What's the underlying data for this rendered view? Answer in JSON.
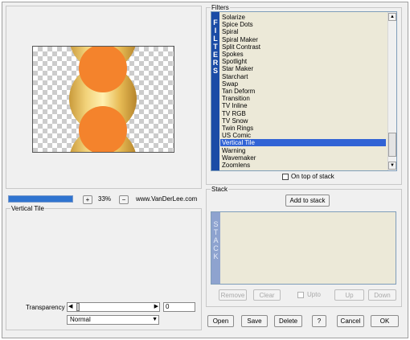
{
  "preview": {
    "zoom_plus": "+",
    "zoom_value": "33%",
    "zoom_minus": "−",
    "credit": "www.VanDerLee.com"
  },
  "settings": {
    "group_label": "Vertical Tile",
    "transparency_label": "Transparency",
    "transparency_value": "0",
    "blend_mode": "Normal"
  },
  "filters": {
    "group_label": "Filters",
    "tab_label": "FILTERS",
    "items": [
      "Solarize",
      "Spice Dots",
      "Spiral",
      "Spiral Maker",
      "Split Contrast",
      "Spokes",
      "Spotlight",
      "Star Maker",
      "Starchart",
      "Swap",
      "Tan Deform",
      "Transition",
      "TV Inline",
      "TV RGB",
      "TV Snow",
      "Twin Rings",
      "US Comic",
      "Vertical Tile",
      "Warning",
      "Wavemaker",
      "Zoomlens"
    ],
    "selected": "Vertical Tile",
    "on_top_label": "On top of stack"
  },
  "stack": {
    "group_label": "Stack",
    "add_button": "Add to stack",
    "tab_label": "STACK",
    "remove_button": "Remove",
    "clear_button": "Clear",
    "upto_label": "Upto",
    "up_button": "Up",
    "down_button": "Down"
  },
  "footer": {
    "open": "Open",
    "save": "Save",
    "delete": "Delete",
    "help": "?",
    "cancel": "Cancel",
    "ok": "OK"
  },
  "colors": {
    "accent": "#3163d5",
    "tab": "#1b4ca6",
    "orange": "#f4832c",
    "gold": "#e2b44a"
  }
}
